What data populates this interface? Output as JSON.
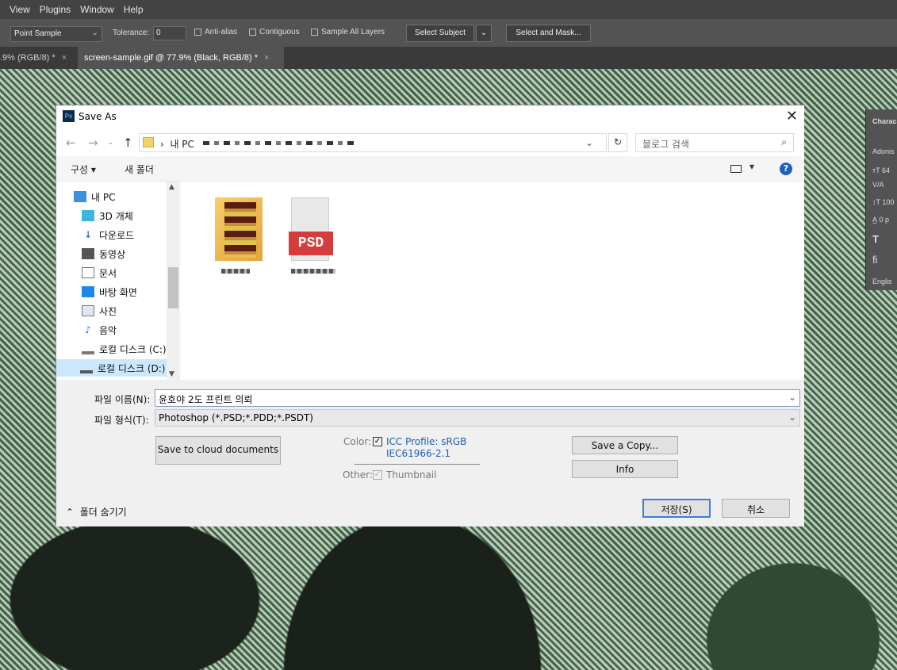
{
  "menu": [
    "View",
    "Plugins",
    "Window",
    "Help"
  ],
  "options": {
    "sample_value": "Point Sample",
    "tolerance_label": "Tolerance:",
    "tolerance_value": "0",
    "antialias": "Anti-alias",
    "contiguous": "Contiguous",
    "sample_all": "Sample All Layers",
    "select_subject": "Select Subject",
    "select_mask": "Select and Mask..."
  },
  "tabs": [
    {
      "label": ".9% (RGB/8) *"
    },
    {
      "label": "screen-sample.gif @ 77.9% (Black, RGB/8) *"
    }
  ],
  "panel": {
    "title": "Charac",
    "font": "Adonis",
    "size": "64",
    "leading": "100",
    "tracking": "0 p",
    "language": "Englis"
  },
  "dialog": {
    "title": "Save As",
    "breadcrumb": "내 PC",
    "search_placeholder": "블로그 검색",
    "organize": "구성 ▾",
    "new_folder": "새 폴더",
    "nav": [
      {
        "label": "내 PC",
        "icon": "computer-icon"
      },
      {
        "label": "3D 개체",
        "icon": "cube-icon"
      },
      {
        "label": "다운로드",
        "icon": "download-icon"
      },
      {
        "label": "동영상",
        "icon": "video-icon"
      },
      {
        "label": "문서",
        "icon": "document-icon"
      },
      {
        "label": "바탕 화면",
        "icon": "desktop-icon"
      },
      {
        "label": "사진",
        "icon": "picture-icon"
      },
      {
        "label": "음악",
        "icon": "music-icon"
      },
      {
        "label": "로컬 디스크 (C:)",
        "icon": "drive-icon"
      },
      {
        "label": "로컬 디스크 (D:)",
        "icon": "drive-icon"
      }
    ],
    "psd_badge": "PSD",
    "filename_label": "파일 이름(N):",
    "filename_value": "윤호야 2도 프린트 의뢰",
    "filetype_label": "파일 형식(T):",
    "filetype_value": "Photoshop (*.PSD;*.PDD;*.PSDT)",
    "cloud_button": "Save to cloud documents",
    "color_label": "Color:",
    "icc_label": "ICC Profile:  sRGB",
    "icc_sub": "IEC61966-2.1",
    "other_label": "Other:",
    "thumbnail_label": "Thumbnail",
    "save_copy": "Save a Copy...",
    "info": "Info",
    "save": "저장(S)",
    "cancel": "취소",
    "hide_folders": "폴더 숨기기"
  }
}
